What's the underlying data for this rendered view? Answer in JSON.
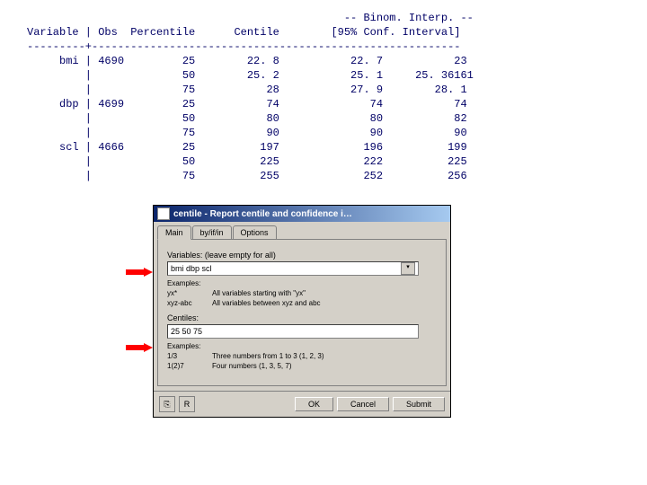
{
  "header1": "                                                 -- Binom. Interp. --",
  "header2": "Variable | Obs  Percentile      Centile        [95% Conf. Interval]",
  "rule": "---------+---------------------------------------------------------",
  "rows": [
    "     bmi | 4690         25        22. 8           22. 7           23",
    "         |              50        25. 2           25. 1     25. 36161",
    "         |              75           28           27. 9        28. 1",
    "     dbp | 4699         25           74              74           74",
    "         |              50           80              80           82",
    "         |              75           90              90           90",
    "     scl | 4666         25          197             196          199",
    "         |              50          225             222          225",
    "         |              75          255             252          256"
  ],
  "dialog": {
    "title": "centile - Report centile and confidence i…",
    "tabs": [
      "Main",
      "by/if/in",
      "Options"
    ],
    "var_label": "Variables: (leave empty for all)",
    "var_value": "bmi dbp scl",
    "ex_label": "Examples:",
    "ex1a": "yx*",
    "ex1b": "All variables starting with \"yx\"",
    "ex2a": "xyz-abc",
    "ex2b": "All variables between xyz and abc",
    "cent_label": "Centiles:",
    "cent_value": "25 50 75",
    "ex3_label": "Examples:",
    "ex3a": "1/3",
    "ex3b": "Three numbers from 1 to 3 (1, 2, 3)",
    "ex4a": "1(2)7",
    "ex4b": "Four numbers (1, 3, 5, 7)",
    "ok": "OK",
    "cancel": "Cancel",
    "submit": "Submit"
  }
}
